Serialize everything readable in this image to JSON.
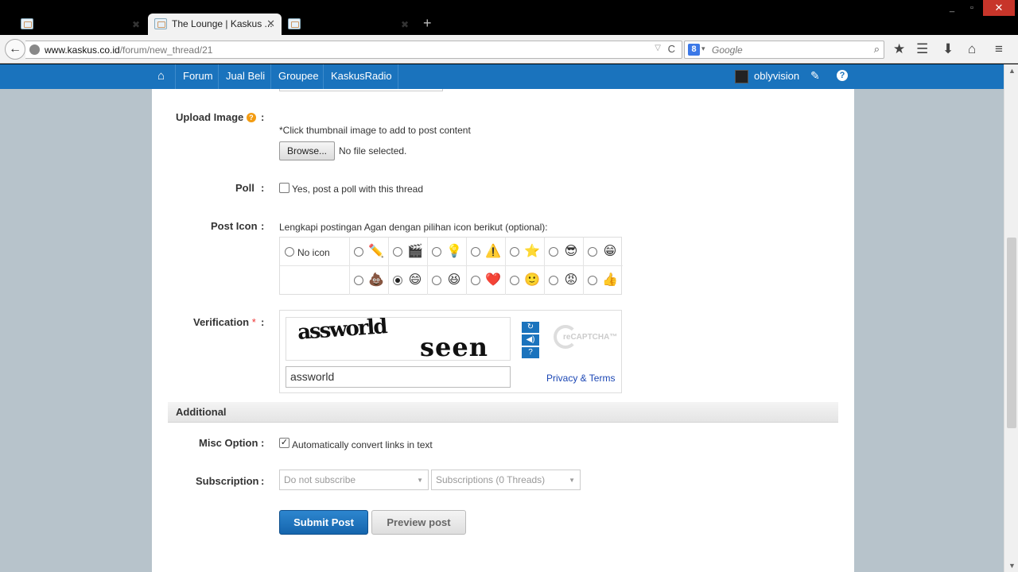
{
  "browser": {
    "active_tab_title": "The Lounge | Kaskus ...",
    "url_domain": "www.kaskus.co.id",
    "url_path": "/forum/new_thread/21",
    "search_placeholder": "Google"
  },
  "site_nav": {
    "items": [
      "Forum",
      "Jual Beli",
      "Groupee",
      "KaskusRadio"
    ],
    "username": "oblyvision"
  },
  "form": {
    "upload_image": {
      "label": "Upload Image",
      "hint": "*Click thumbnail image to add to post content",
      "browse_label": "Browse...",
      "file_status": "No file selected."
    },
    "poll": {
      "label": "Poll",
      "checkbox_label": "Yes, post a poll with this thread",
      "checked": false
    },
    "post_icon": {
      "label": "Post Icon",
      "instruction": "Lengkapi postingan Agan dengan pilihan icon berikut (optional):",
      "no_icon_label": "No icon",
      "selected": "smiley-grin-red",
      "icons_row1": [
        "pencil",
        "clapperboard",
        "lightbulb",
        "warning",
        "star",
        "cool-sunglasses",
        "smiley-grin"
      ],
      "icons_row2": [
        "poop",
        "smiley-grin-red",
        "laughing",
        "heart",
        "blue-smiley",
        "angry-red",
        "thumbs-up-hand"
      ]
    },
    "verification": {
      "label": "Verification",
      "required_mark": "*",
      "captcha_word1": "assworld",
      "captcha_word2": "seen",
      "input_value": "assworld",
      "recaptcha_text": "reCAPTCHA™",
      "privacy_link": "Privacy & Terms"
    },
    "additional": {
      "section_title": "Additional",
      "misc_label": "Misc Option",
      "misc_checkbox_label": "Automatically convert links in text",
      "misc_checked": true,
      "subscription_label": "Subscription",
      "subscription_select": "Do not subscribe",
      "subscriptions_select": "Subscriptions (0 Threads)"
    },
    "submit_label": "Submit Post",
    "preview_label": "Preview post"
  },
  "colors": {
    "brand_blue": "#1a73bd",
    "page_bg": "#b7c3cb"
  }
}
